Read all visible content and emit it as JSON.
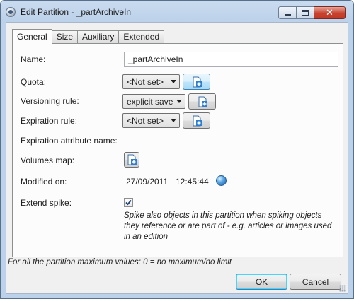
{
  "window": {
    "title": "Edit Partition - _partArchiveIn"
  },
  "tabs": [
    {
      "label": "General",
      "active": true
    },
    {
      "label": "Size",
      "active": false
    },
    {
      "label": "Auxiliary",
      "active": false
    },
    {
      "label": "Extended",
      "active": false
    }
  ],
  "form": {
    "name_label": "Name:",
    "name_value": "_partArchiveIn",
    "quota_label": "Quota:",
    "quota_value": "<Not set>",
    "versioning_label": "Versioning rule:",
    "versioning_value": "explicit save",
    "expiration_label": "Expiration rule:",
    "expiration_value": "<Not set>",
    "expiration_attr_label": "Expiration attribute name:",
    "volumes_label": "Volumes map:",
    "modified_label": "Modified on:",
    "modified_date": "27/09/2011",
    "modified_time": "12:45:44",
    "extend_spike_label": "Extend spike:",
    "extend_spike_checked": true,
    "extend_spike_note": "Spike also objects in this partition when spiking objects they reference or are part of - e.g. articles or images used in an edition"
  },
  "footer_note": "For all the partition maximum values: 0 = no maximum/no limit",
  "buttons": {
    "ok_mnemonic": "O",
    "ok_rest": "K",
    "cancel_label": "Cancel"
  },
  "icons": {
    "edit": "document-add-icon",
    "globe": "globe-icon",
    "app": "partition-app-icon"
  }
}
